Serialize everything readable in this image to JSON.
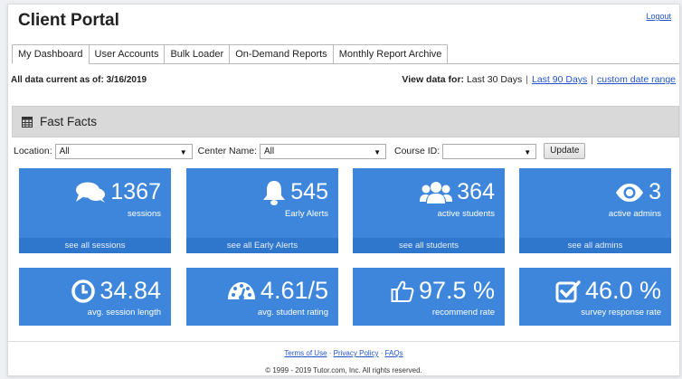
{
  "app": {
    "title": "Client Portal",
    "logout_label": "Logout"
  },
  "tabs": [
    {
      "label": "My Dashboard"
    },
    {
      "label": "User Accounts"
    },
    {
      "label": "Bulk Loader"
    },
    {
      "label": "On-Demand Reports"
    },
    {
      "label": "Monthly Report Archive"
    }
  ],
  "status": {
    "current_as_of": "All data current as of: 3/16/2019"
  },
  "date_range": {
    "label": "View data for:",
    "current": "Last 30 Days",
    "option_90": "Last 90 Days",
    "option_custom": "custom date range",
    "separator": "|"
  },
  "fast_facts": {
    "title": "Fast Facts",
    "icon": "table-grid-icon"
  },
  "filters": {
    "location_label": "Location:",
    "location_value": "All",
    "center_label": "Center Name:",
    "center_value": "All",
    "course_label": "Course ID:",
    "course_value": "",
    "update_label": "Update"
  },
  "cards": [
    {
      "icon": "comments-icon",
      "value": "1367",
      "label": "sessions",
      "link": "see all sessions"
    },
    {
      "icon": "bell-icon",
      "value": "545",
      "label": "Early Alerts",
      "link": "see all Early Alerts"
    },
    {
      "icon": "users-icon",
      "value": "364",
      "label": "active students",
      "link": "see all students"
    },
    {
      "icon": "eye-icon",
      "value": "3",
      "label": "active admins",
      "link": "see all admins"
    },
    {
      "icon": "clock-icon",
      "value": "34.84",
      "label": "avg. session length"
    },
    {
      "icon": "dashboard-gauge-icon",
      "value": "4.61/5",
      "label": "avg. student rating"
    },
    {
      "icon": "thumbs-up-icon",
      "value": "97.5 %",
      "label": "recommend rate"
    },
    {
      "icon": "check-square-icon",
      "value": "46.0 %",
      "label": "survey response rate"
    }
  ],
  "footer": {
    "terms": "Terms of Use",
    "privacy": "Privacy Policy",
    "faqs": "FAQs",
    "dot": "·",
    "copyright": "© 1999 - 2019 Tutor.com, Inc. All rights reserved."
  },
  "colors": {
    "card_bg": "#3d86dc",
    "card_footer": "#2f76cd",
    "link": "#2255cc"
  }
}
